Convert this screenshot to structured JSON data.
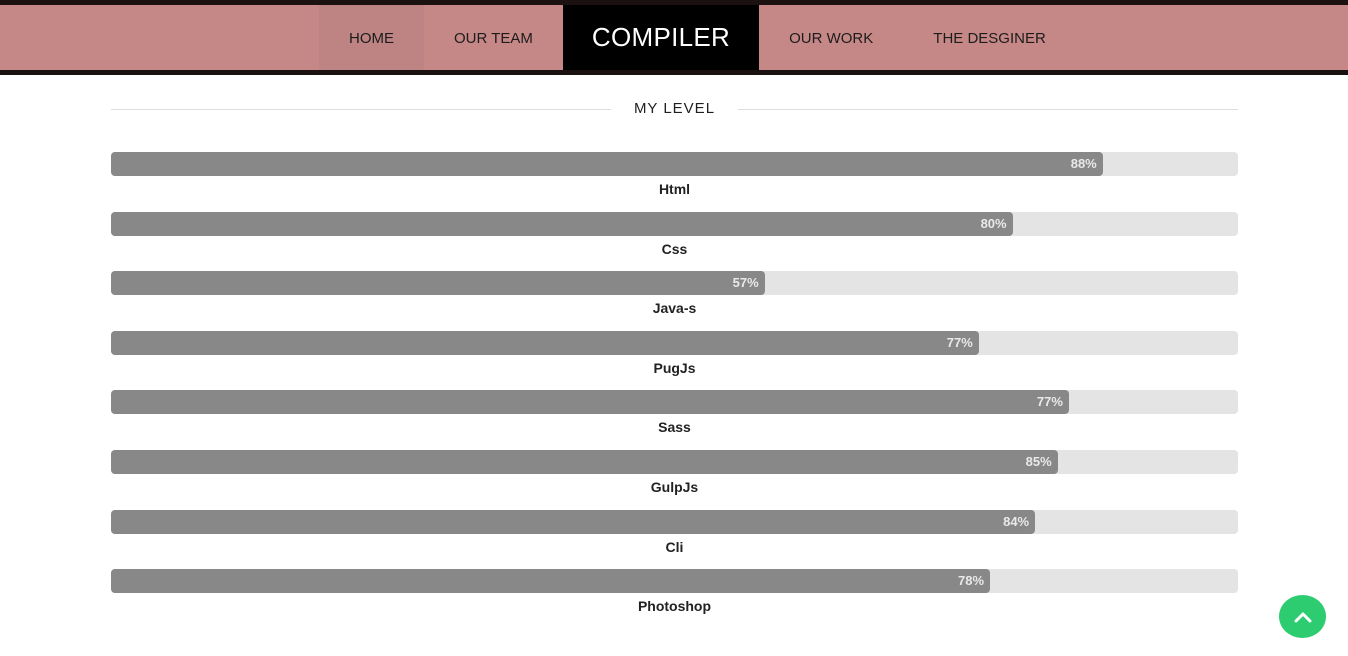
{
  "nav": {
    "items": [
      {
        "label": "HOME",
        "active": true
      },
      {
        "label": "OUR TEAM",
        "active": false
      },
      {
        "label": "COMPILER",
        "brand": true
      },
      {
        "label": "OUR WORK",
        "active": false
      },
      {
        "label": "THE DESGINER",
        "active": false
      }
    ]
  },
  "section": {
    "title": "MY LEVEL"
  },
  "skills": [
    {
      "name": "Html",
      "percent": 88,
      "percent_label": "88%"
    },
    {
      "name": "Css",
      "percent": 80,
      "percent_label": "80%"
    },
    {
      "name": "Java-s",
      "percent": 58,
      "percent_label": "57%"
    },
    {
      "name": "PugJs",
      "percent": 77,
      "percent_label": "77%"
    },
    {
      "name": "Sass",
      "percent": 85,
      "percent_label": "77%"
    },
    {
      "name": "GulpJs",
      "percent": 84,
      "percent_label": "85%"
    },
    {
      "name": "Cli",
      "percent": 82,
      "percent_label": "84%"
    },
    {
      "name": "Photoshop",
      "percent": 78,
      "percent_label": "78%"
    }
  ],
  "scroll_top": {
    "icon": "chevron-up-icon",
    "color": "#2ecc71"
  },
  "colors": {
    "navbar": "#c68886",
    "navbar_active": "#bd8483",
    "brand_bg": "#000000",
    "bar_fill": "#888888",
    "bar_track": "#e4e4e4"
  }
}
